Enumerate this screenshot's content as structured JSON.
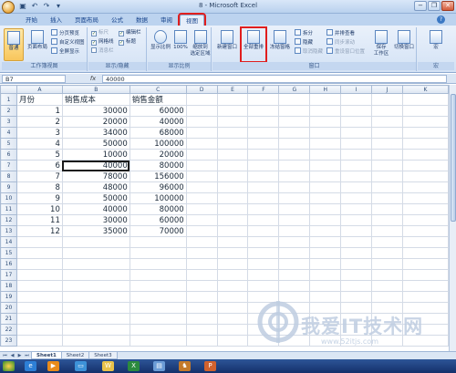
{
  "window": {
    "title": "8 - Microsoft Excel",
    "minimize": "−",
    "restore": "❐",
    "close": "✕"
  },
  "qat": [
    "save-icon",
    "undo-icon",
    "redo-icon",
    "dropdown-icon"
  ],
  "tabs": [
    {
      "label": "开始",
      "active": false
    },
    {
      "label": "插入",
      "active": false
    },
    {
      "label": "页面布局",
      "active": false
    },
    {
      "label": "公式",
      "active": false
    },
    {
      "label": "数据",
      "active": false
    },
    {
      "label": "审阅",
      "active": false
    },
    {
      "label": "视图",
      "active": true
    }
  ],
  "ribbon": {
    "workbook_views": {
      "label": "工作簿视图",
      "normal": "普通",
      "page_layout": "页面布局",
      "page_break": "分页预览",
      "custom_views": "自定义视图",
      "full_screen": "全屏显示"
    },
    "show_hide": {
      "label": "显示/隐藏",
      "ruler": "标尺",
      "formula_bar": "编辑栏",
      "gridlines": "网格线",
      "headings": "标题",
      "message_bar": "消息栏"
    },
    "zoom": {
      "label": "显示比例",
      "zoom": "显示比例",
      "hundred": "100%",
      "to_selection_1": "缩放到",
      "to_selection_2": "选定区域"
    },
    "window": {
      "label": "窗口",
      "new_window": "新建窗口",
      "arrange_all": "全部重排",
      "freeze_panes": "冻结窗格",
      "split": "拆分",
      "hide": "隐藏",
      "unhide": "取消隐藏",
      "side_by_side": "并排查看",
      "sync_scroll": "同步滚动",
      "reset_position": "重设窗口位置",
      "save_workspace_1": "保存",
      "save_workspace_2": "工作区",
      "switch_windows_1": "切换窗口"
    },
    "macros": {
      "label": "宏",
      "macros": "宏"
    }
  },
  "formula_bar": {
    "name_box": "B7",
    "fx": "fx",
    "value": "40000"
  },
  "columns": [
    "A",
    "B",
    "C",
    "D",
    "E",
    "F",
    "G",
    "H",
    "I",
    "J",
    "K"
  ],
  "rows": [
    [
      "月份",
      "销售成本",
      "销售金额"
    ],
    [
      "1",
      "30000",
      "60000"
    ],
    [
      "2",
      "20000",
      "40000"
    ],
    [
      "3",
      "34000",
      "68000"
    ],
    [
      "4",
      "50000",
      "100000"
    ],
    [
      "5",
      "10000",
      "20000"
    ],
    [
      "6",
      "40000",
      "80000"
    ],
    [
      "7",
      "78000",
      "156000"
    ],
    [
      "8",
      "48000",
      "96000"
    ],
    [
      "9",
      "50000",
      "100000"
    ],
    [
      "10",
      "40000",
      "80000"
    ],
    [
      "11",
      "30000",
      "60000"
    ],
    [
      "12",
      "35000",
      "70000"
    ]
  ],
  "sheets": [
    {
      "label": "Sheet1",
      "active": true
    },
    {
      "label": "Sheet2",
      "active": false
    },
    {
      "label": "Sheet3",
      "active": false
    }
  ],
  "taskbar": [
    "start-icon",
    "ie-icon",
    "media-icon",
    "folder-icon",
    "excel-icon",
    "word-icon",
    "explorer-icon",
    "game-icon",
    "ppt-icon"
  ],
  "watermark": {
    "text": "我爱IT技术网",
    "url": "www.52itjs.com"
  },
  "colors": {
    "highlight": "#e01e1e",
    "ribbon_blue": "#15428b"
  }
}
